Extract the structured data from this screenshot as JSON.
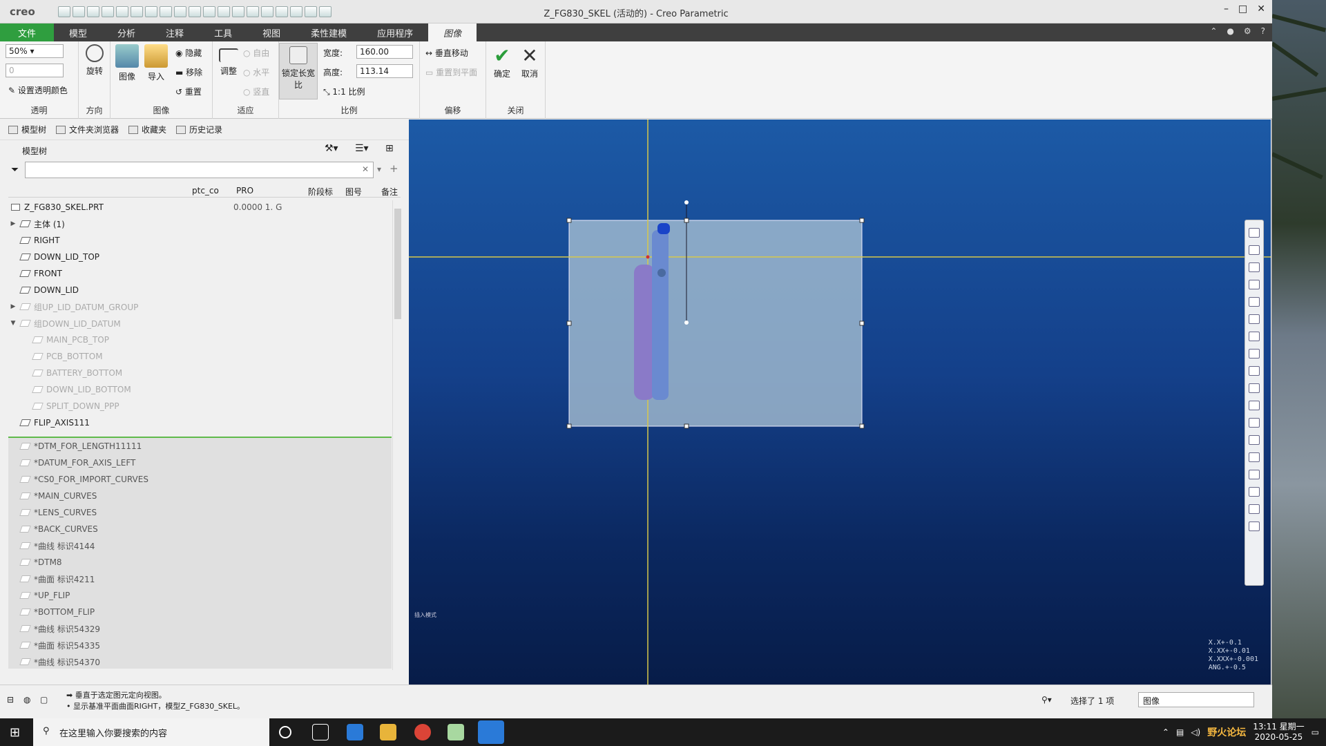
{
  "app": {
    "logo": "creo",
    "window_title": "Z_FG830_SKEL (活动的) - Creo Parametric"
  },
  "tabs": [
    "文件",
    "模型",
    "分析",
    "注释",
    "工具",
    "视图",
    "柔性建模",
    "应用程序",
    "图像"
  ],
  "ribbon": {
    "transparency": {
      "value": "50%",
      "value2": "0",
      "set_color": "设置透明颜色",
      "label": "透明"
    },
    "direction": {
      "rotate": "旋转",
      "label": "方向"
    },
    "image": {
      "image_btn": "图像",
      "import_btn": "导入",
      "hide": "隐藏",
      "remove": "移除",
      "reset": "重置",
      "label": "图像"
    },
    "fit": {
      "adjust": "调整",
      "free": "自由",
      "horizontal": "水平",
      "vertical": "竖直",
      "label": "适应"
    },
    "scale": {
      "lock_aspect": "锁定长宽比",
      "width_label": "宽度:",
      "width_value": "160.00",
      "height_label": "高度:",
      "height_value": "113.14",
      "ratio": "1:1 比例",
      "label": "比例"
    },
    "offset": {
      "vertical_move": "垂直移动",
      "to_plane": "重置到平面",
      "label": "偏移"
    },
    "close": {
      "ok": "确定",
      "cancel": "取消",
      "label": "关闭"
    }
  },
  "panel_tabs": [
    "模型树",
    "文件夹浏览器",
    "收藏夹",
    "历史记录"
  ],
  "tree": {
    "title": "模型树",
    "columns": [
      "ptc_co",
      "PRO",
      "阶段标",
      "图号",
      "备注"
    ],
    "root": {
      "name": "Z_FG830_SKEL.PRT",
      "value": "0.0000 1. G"
    },
    "items": [
      {
        "name": "主体 (1)",
        "expand": "▶",
        "dim": false
      },
      {
        "name": "RIGHT",
        "expand": "",
        "dim": false
      },
      {
        "name": "DOWN_LID_TOP",
        "expand": "",
        "dim": false
      },
      {
        "name": "FRONT",
        "expand": "",
        "dim": false
      },
      {
        "name": "DOWN_LID",
        "expand": "",
        "dim": false
      },
      {
        "name": "组UP_LID_DATUM_GROUP",
        "expand": "▶",
        "dim": true
      },
      {
        "name": "组DOWN_LID_DATUM",
        "expand": "▼",
        "dim": true
      },
      {
        "name": "MAIN_PCB_TOP",
        "expand": "",
        "dim": true,
        "indent": true
      },
      {
        "name": "PCB_BOTTOM",
        "expand": "",
        "dim": true,
        "indent": true
      },
      {
        "name": "BATTERY_BOTTOM",
        "expand": "",
        "dim": true,
        "indent": true
      },
      {
        "name": "DOWN_LID_BOTTOM",
        "expand": "",
        "dim": true,
        "indent": true
      },
      {
        "name": "SPLIT_DOWN_PPP",
        "expand": "",
        "dim": true,
        "indent": true
      },
      {
        "name": "FLIP_AXIS111",
        "expand": "",
        "dim": false
      }
    ],
    "insert_items": [
      "*DTM_FOR_LENGTH11111",
      "*DATUM_FOR_AXIS_LEFT",
      "*CS0_FOR_IMPORT_CURVES",
      "*MAIN_CURVES",
      "*LENS_CURVES",
      "*BACK_CURVES",
      "*曲线 标识4144",
      "*DTM8",
      "*曲面 标识4211",
      "*UP_FLIP",
      "*BOTTOM_FLIP",
      "*曲线 标识54329",
      "*曲面 标识54335",
      "*曲线 标识54370"
    ]
  },
  "viewport": {
    "mode_label": "插入模式",
    "tolerances": [
      "X.X+-0.1",
      "X.XX+-0.01",
      "X.XXX+-0.001",
      "ANG.+-0.5"
    ]
  },
  "status": {
    "msg1": "垂直于选定图元定向视图。",
    "msg2": "显示基准平面曲面RIGHT，模型Z_FG830_SKEL。",
    "selected": "选择了 1 项",
    "filter": "图像"
  },
  "taskbar": {
    "search": "在这里输入你要搜索的内容",
    "time": "13:11 星期一",
    "date": "2020-05-25"
  },
  "watermark": "野火论坛"
}
